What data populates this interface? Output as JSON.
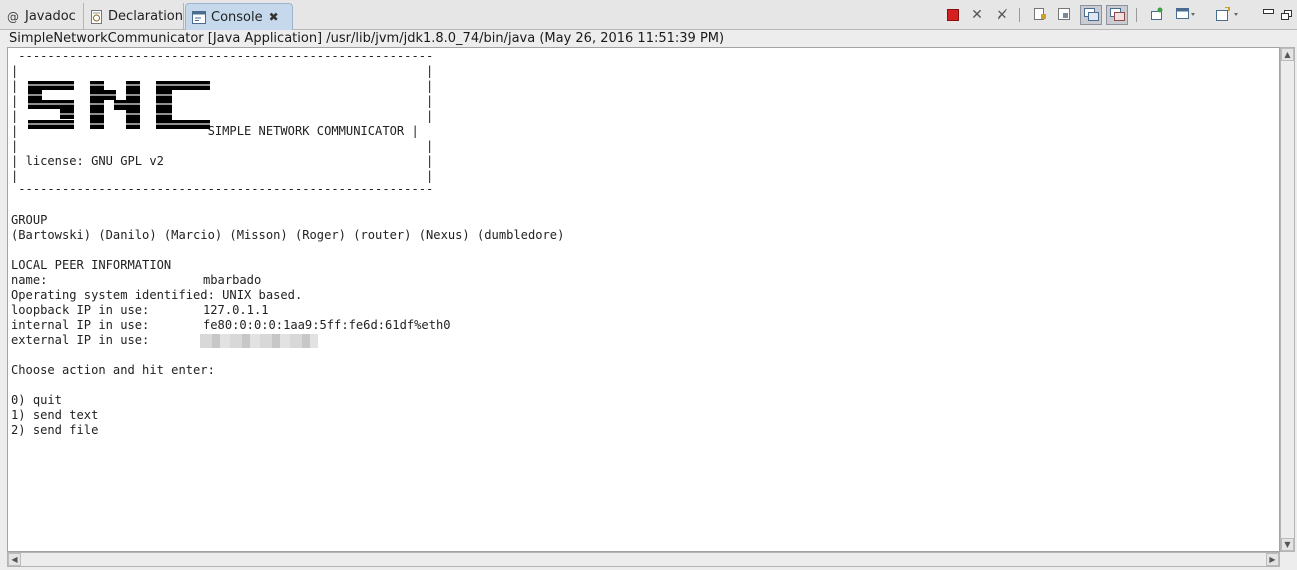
{
  "tabs": [
    {
      "label": "Javadoc",
      "icon": "at-sign-icon",
      "active": false
    },
    {
      "label": "Declaration",
      "icon": "declaration-icon",
      "active": false
    },
    {
      "label": "Console",
      "icon": "console-icon",
      "active": true
    }
  ],
  "toolbar_icons": [
    "terminate-icon",
    "remove-launch-icon",
    "remove-all-terminated-icon",
    "scroll-lock-icon",
    "word-wrap-icon",
    "show-on-stdout-icon",
    "show-on-stderr-icon",
    "pin-console-icon",
    "display-selected-console-icon",
    "open-console-icon",
    "minimize-icon",
    "maximize-icon"
  ],
  "process_title": "SimpleNetworkCommunicator [Java Application] /usr/lib/jvm/jdk1.8.0_74/bin/java (May 26, 2016 11:51:39 PM)",
  "console": {
    "banner_border_top": " ---------------------------------------------------------",
    "banner_subtitle": "SIMPLE NETWORK COMMUNICATOR",
    "banner_logo": "SNC",
    "license": "license: GNU GPL v2",
    "banner_border_bottom": " ---------------------------------------------------------",
    "group_header": "GROUP",
    "group_members": "(Bartowski) (Danilo) (Marcio) (Misson) (Roger) (router) (Nexus) (dumbledore)",
    "peer_header": "LOCAL PEER INFORMATION",
    "name_label": "name:",
    "name_value": "mbarbado",
    "os_line": "Operating system identified: UNIX based.",
    "loopback_label": "loopback IP in use:",
    "loopback_value": "127.0.1.1",
    "internal_label": "internal IP in use:",
    "internal_value": "fe80:0:0:0:1aa9:5ff:fe6d:61df%eth0",
    "external_label": "external IP in use:",
    "prompt": "Choose action and hit enter:",
    "options": [
      "0) quit",
      "1) send text",
      "2) send file"
    ]
  },
  "colors": {
    "terminate_red": "#d42020",
    "active_tab": "#c6d9ec"
  }
}
